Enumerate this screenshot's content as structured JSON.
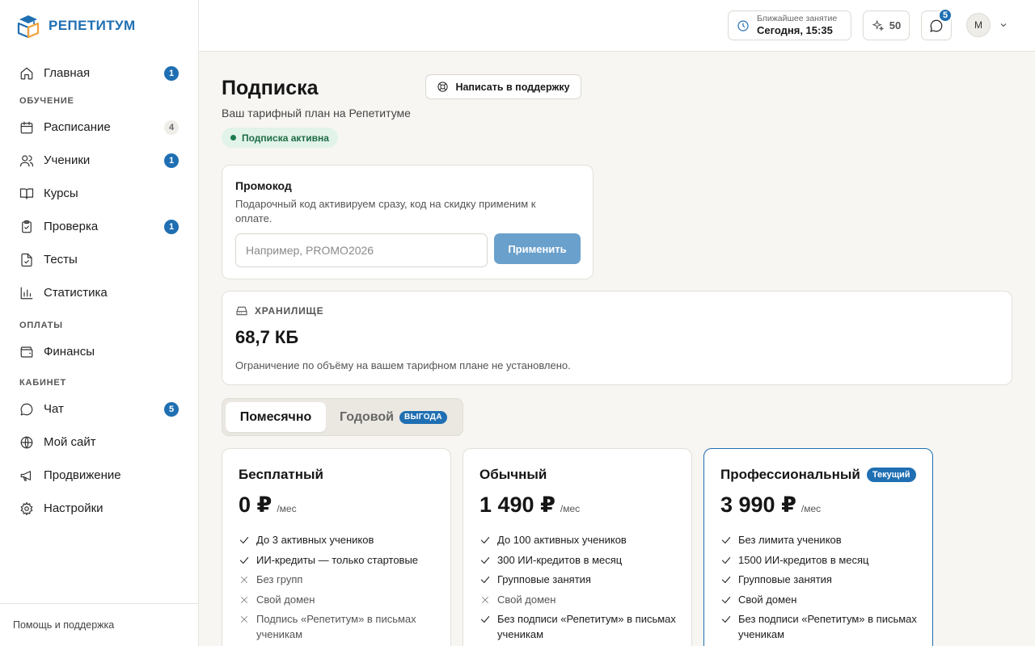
{
  "brand": {
    "name": "РЕПЕТИТУМ",
    "accent": "#1f6fb2"
  },
  "sidebar": {
    "items": [
      {
        "label": "Главная",
        "icon": "home-icon",
        "badge": "1"
      },
      {
        "label": "Расписание",
        "icon": "calendar-icon",
        "badge": "4"
      },
      {
        "label": "Ученики",
        "icon": "users-icon",
        "badge": "1"
      },
      {
        "label": "Курсы",
        "icon": "book-icon",
        "badge": null
      },
      {
        "label": "Проверка",
        "icon": "clipboard-check-icon",
        "badge": "1"
      },
      {
        "label": "Тесты",
        "icon": "file-check-icon",
        "badge": null
      },
      {
        "label": "Статистика",
        "icon": "bar-chart-icon",
        "badge": null
      },
      {
        "label": "Финансы",
        "icon": "wallet-icon",
        "badge": null
      },
      {
        "label": "Чат",
        "icon": "chat-icon",
        "badge": "5"
      },
      {
        "label": "Мой сайт",
        "icon": "globe-icon",
        "badge": null
      },
      {
        "label": "Продвижение",
        "icon": "megaphone-icon",
        "badge": null
      },
      {
        "label": "Настройки",
        "icon": "gear-icon",
        "badge": null
      }
    ],
    "sections": {
      "learning": "ОБУЧЕНИЕ",
      "payments": "ОПЛАТЫ",
      "cabinet": "КАБИНЕТ"
    },
    "footer": "Помощь и поддержка"
  },
  "topbar": {
    "next_lesson_caption": "Ближайшее занятие",
    "next_lesson_value": "Сегодня, 15:35",
    "credits": "50",
    "chat_badge": "5",
    "avatar_initial": "М"
  },
  "page": {
    "title": "Подписка",
    "support_button": "Написать в поддержку",
    "subtitle": "Ваш тарифный план на Репетитуме",
    "status": "Подписка активна"
  },
  "promo": {
    "title": "Промокод",
    "description": "Подарочный код активируем сразу, код на скидку применим к оплате.",
    "placeholder": "Например, PROMO2026",
    "value": "",
    "apply_label": "Применить"
  },
  "storage": {
    "heading": "ХРАНИЛИЩЕ",
    "value": "68,7 КБ",
    "note": "Ограничение по объёму на вашем тарифном плане не установлено."
  },
  "billing_period": {
    "monthly": "Помесячно",
    "yearly": "Годовой",
    "yearly_tag": "ВЫГОДА",
    "selected": "monthly"
  },
  "plans": [
    {
      "name": "Бесплатный",
      "price": "0 ₽",
      "per": "/мес",
      "tag": null,
      "features": [
        {
          "text": "До 3 активных учеников",
          "included": true
        },
        {
          "text": "ИИ-кредиты — только стартовые",
          "included": true
        },
        {
          "text": "Без групп",
          "included": false
        },
        {
          "text": "Свой домен",
          "included": false
        },
        {
          "text": "Подпись «Репетитум» в письмах ученикам",
          "included": false
        }
      ]
    },
    {
      "name": "Обычный",
      "price": "1 490 ₽",
      "per": "/мес",
      "tag": null,
      "features": [
        {
          "text": "До 100 активных учеников",
          "included": true
        },
        {
          "text": "300 ИИ-кредитов в месяц",
          "included": true
        },
        {
          "text": "Групповые занятия",
          "included": true
        },
        {
          "text": "Свой домен",
          "included": false
        },
        {
          "text": "Без подписи «Репетитум» в письмах ученикам",
          "included": true
        }
      ]
    },
    {
      "name": "Профессиональный",
      "price": "3 990 ₽",
      "per": "/мес",
      "tag": "Текущий",
      "features": [
        {
          "text": "Без лимита учеников",
          "included": true
        },
        {
          "text": "1500 ИИ-кредитов в месяц",
          "included": true
        },
        {
          "text": "Групповые занятия",
          "included": true
        },
        {
          "text": "Свой домен",
          "included": true
        },
        {
          "text": "Без подписи «Репетитум» в письмах ученикам",
          "included": true
        }
      ]
    }
  ]
}
